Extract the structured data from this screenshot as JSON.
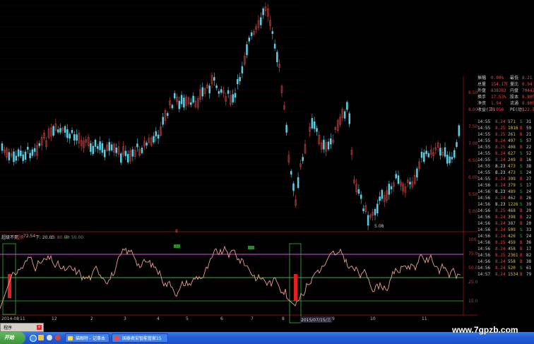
{
  "indicator": {
    "name": "超级不死",
    "sub_name": "超卖",
    "val1": "72.54",
    "val2": "下: 20.00",
    "val3": "上: 80.00",
    "val4": "中: 50.00",
    "levels": [
      80,
      50,
      20
    ],
    "labels": [
      "100.00",
      "75.00",
      "50.00",
      "25.00",
      "15.00"
    ],
    "cross_marker": "8"
  },
  "main": {
    "low_label": "5.08",
    "date_left": "2014-08",
    "date_tip": "2015/07/15/三",
    "axis_ticks": [
      "11",
      "12",
      "2",
      "3",
      "4",
      "5",
      "6",
      "7",
      "8",
      "9",
      "10",
      "11"
    ]
  },
  "price_scale": [
    "8.50",
    "8.00",
    "7.50",
    "7.00",
    "6.50",
    "6.00",
    "5.50",
    "5.00"
  ],
  "quote": {
    "header": [
      {
        "a": "振幅",
        "b": "0.00%",
        "c": "最低",
        "d": "8.21"
      },
      {
        "a": "总量",
        "b": "154.1万",
        "c": "量比",
        "d": "0.94"
      },
      {
        "a": "外盘",
        "b": "838282",
        "c": "内盘",
        "d": "704425"
      },
      {
        "a": "换手",
        "b": "17.53%",
        "c": "股本",
        "d": "8.80亿"
      },
      {
        "a": "净资",
        "b": "1.94",
        "c": "流通",
        "d": "8.80亿"
      },
      {
        "a": "收益(三)",
        "b": "0.058",
        "c": "PE(动)",
        "d": "122.5"
      }
    ],
    "ticks": [
      {
        "t": "14:55",
        "p": "8.24",
        "v": "571",
        "f": "S",
        "n": "31"
      },
      {
        "t": "14:55",
        "p": "8.25",
        "v": "1816",
        "f": "B",
        "n": "59"
      },
      {
        "t": "14:55",
        "p": "8.25",
        "v": "261",
        "f": "B",
        "n": "21"
      },
      {
        "t": "14:55",
        "p": "8.24",
        "v": "497",
        "f": "S",
        "n": "57"
      },
      {
        "t": "14:55",
        "p": "8.25",
        "v": "408",
        "f": "B",
        "n": "22"
      },
      {
        "t": "14:55",
        "p": "8.24",
        "v": "627",
        "f": "S",
        "n": "52"
      },
      {
        "t": "14:55",
        "p": "8.24",
        "v": "249",
        "f": "B",
        "n": "16"
      },
      {
        "t": "14:55",
        "p": "8.23",
        "v": "473",
        "f": "S",
        "n": "38"
      },
      {
        "t": "14:55",
        "p": "8.23",
        "v": "473",
        "f": "S",
        "n": "24"
      },
      {
        "t": "14:55",
        "p": "8.24",
        "v": "399",
        "f": "B",
        "n": "27"
      },
      {
        "t": "14:56",
        "p": "8.24",
        "v": "379",
        "f": "S",
        "n": "17"
      },
      {
        "t": "14:56",
        "p": "8.23",
        "v": "489",
        "f": "S",
        "n": "24"
      },
      {
        "t": "14:56",
        "p": "8.24",
        "v": "462",
        "f": "B",
        "n": "26"
      },
      {
        "t": "14:56",
        "p": "8.23",
        "v": "1226",
        "f": "S",
        "n": "39"
      },
      {
        "t": "14:56",
        "p": "8.25",
        "v": "468",
        "f": "B",
        "n": "29"
      },
      {
        "t": "14:56",
        "p": "8.24",
        "v": "398",
        "f": "B",
        "n": "22"
      },
      {
        "t": "14:56",
        "p": "8.24",
        "v": "387",
        "f": "B",
        "n": "20"
      },
      {
        "t": "14:56",
        "p": "8.24",
        "v": "509",
        "f": "S",
        "n": "33"
      },
      {
        "t": "14:56",
        "p": "8.24",
        "v": "426",
        "f": "S",
        "n": "24"
      },
      {
        "t": "14:56",
        "p": "8.25",
        "v": "459",
        "f": "B",
        "n": "36"
      },
      {
        "t": "14:56",
        "p": "8.24",
        "v": "458",
        "f": "B",
        "n": "17"
      },
      {
        "t": "14:56",
        "p": "8.25",
        "v": "2361",
        "f": "B",
        "n": "82"
      },
      {
        "t": "14:56",
        "p": "8.24",
        "v": "558",
        "f": "B",
        "n": "38"
      },
      {
        "t": "14:56",
        "p": "8.24",
        "v": "520",
        "f": "S",
        "n": "61"
      },
      {
        "t": "14:57",
        "p": "8.24",
        "v": "1534",
        "f": "B",
        "n": "79"
      }
    ]
  },
  "taskbar": {
    "start": "开始",
    "task1": "猫眼特 - 记事本",
    "task2": "国泰君安智能管家15"
  },
  "popup": {
    "title": "程序"
  },
  "watermark": "www.7gpzb.com",
  "colors": {
    "up": "#e04a4a",
    "down": "#5ad0e6",
    "osc": "#e8a090",
    "level_hi": "#b044b0",
    "level_mid": "#3cb03c",
    "frame": "#7a1010"
  }
}
